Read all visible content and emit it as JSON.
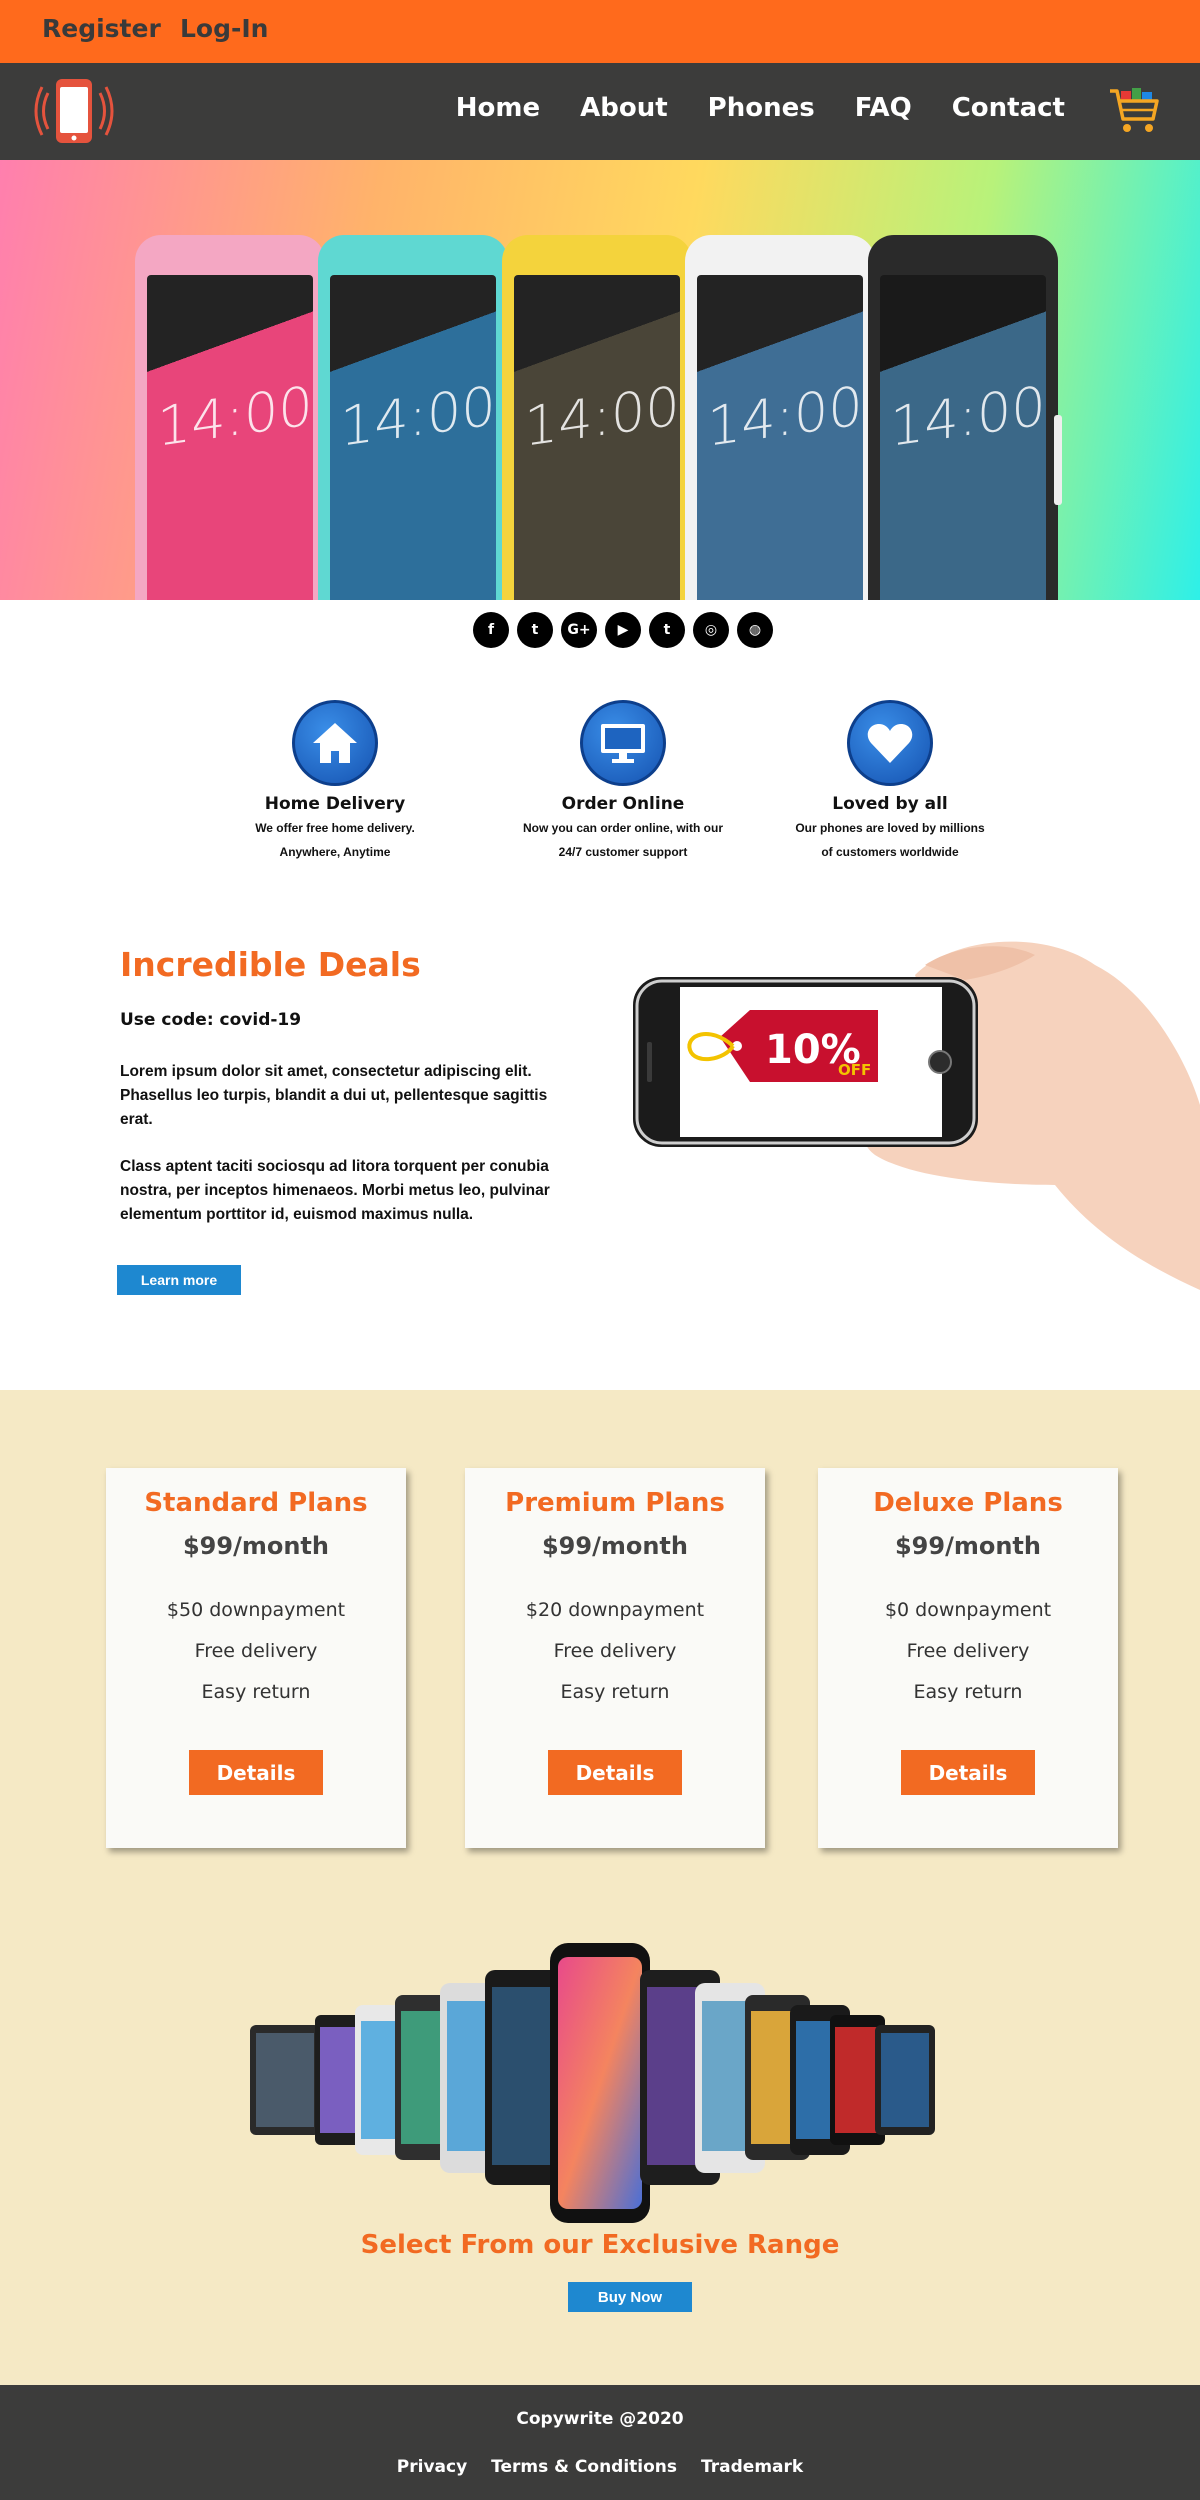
{
  "topbar": {
    "register": "Register",
    "login": "Log-In"
  },
  "nav": {
    "items": [
      "Home",
      "About",
      "Phones",
      "FAQ",
      "Contact"
    ]
  },
  "hero": {
    "phone_time": "14:00",
    "phone_colors": [
      "#e8457a",
      "#2fb0c2",
      "#3a3a34",
      "#4b7aa8",
      "#3d6b8f"
    ]
  },
  "social": [
    "f",
    "t",
    "G+",
    "▶",
    "t",
    "◎",
    "◍"
  ],
  "features": [
    {
      "title": "Home Delivery",
      "line1": "We offer free home delivery.",
      "line2": "Anywhere, Anytime"
    },
    {
      "title": "Order Online",
      "line1": "Now you can order online, with our",
      "line2": "24/7 customer support"
    },
    {
      "title": "Loved by all",
      "line1": "Our phones are loved by millions",
      "line2": "of customers worldwide"
    }
  ],
  "deals": {
    "title": "Incredible Deals",
    "code": "Use code: covid-19",
    "p1": "Lorem ipsum dolor sit amet, consectetur adipiscing elit. Phasellus leo turpis, blandit a dui ut, pellentesque sagittis erat.",
    "p2": "Class aptent taciti sociosqu ad litora torquent per conubia nostra, per inceptos himenaeos. Morbi metus leo, pulvinar elementum porttitor id, euismod maximus nulla.",
    "button": "Learn more",
    "tag_value": "10%",
    "tag_off": "OFF"
  },
  "plans": [
    {
      "name": "Standard Plans",
      "price": "$99/month",
      "f1": "$50 downpayment",
      "f2": "Free delivery",
      "f3": "Easy return",
      "button": "Details"
    },
    {
      "name": "Premium Plans",
      "price": "$99/month",
      "f1": "$20 downpayment",
      "f2": "Free delivery",
      "f3": "Easy return",
      "button": "Details"
    },
    {
      "name": "Deluxe Plans",
      "price": "$99/month",
      "f1": "$0 downpayment",
      "f2": "Free delivery",
      "f3": "Easy return",
      "button": "Details"
    }
  ],
  "range": {
    "title": "Select From our Exclusive Range",
    "button": "Buy Now"
  },
  "footer": {
    "copyright": "Copywrite @2020",
    "links": [
      "Privacy",
      "Terms & Conditions",
      "Trademark"
    ]
  },
  "colors": {
    "orange": "#ff6a1c",
    "dark": "#3c3c3b",
    "blue": "#1e88d0",
    "cream": "#f5e9c5"
  }
}
